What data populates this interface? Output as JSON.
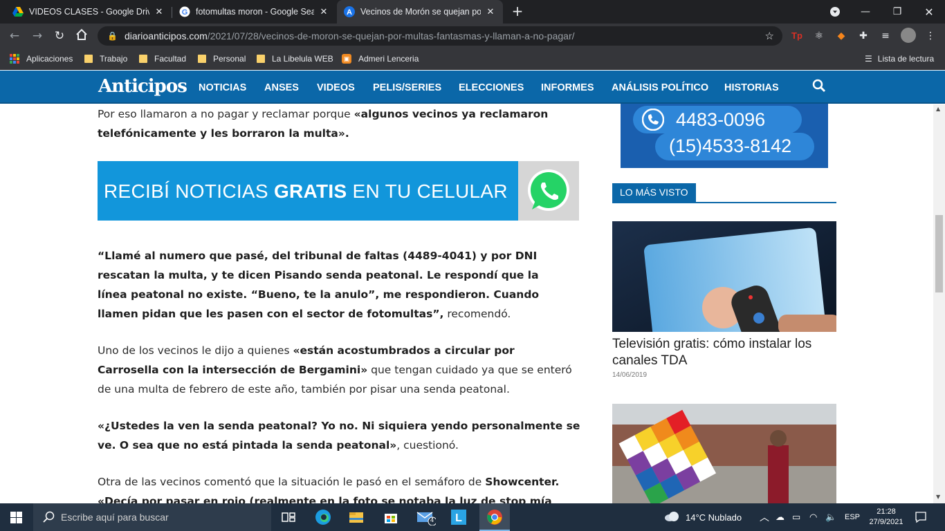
{
  "browser": {
    "tabs": [
      {
        "title": "VIDEOS CLASES - Google Drive",
        "icon": "google-drive-icon"
      },
      {
        "title": "fotomultas moron - Google Search",
        "icon": "google-icon"
      },
      {
        "title": "Vecinos de Morón se quejan por",
        "icon": "site-icon"
      }
    ],
    "url_host": "diarioanticipos.com",
    "url_path": "/2021/07/28/vecinos-de-moron-se-quejan-por-multas-fantasmas-y-llaman-a-no-pagar/",
    "bookmarks": [
      {
        "label": "Aplicaciones",
        "icon": "apps-grid-icon"
      },
      {
        "label": "Trabajo",
        "icon": "folder-icon"
      },
      {
        "label": "Facultad",
        "icon": "folder-icon"
      },
      {
        "label": "Personal",
        "icon": "folder-icon"
      },
      {
        "label": "La Libelula WEB",
        "icon": "folder-icon"
      },
      {
        "label": "Admeri Lenceria",
        "icon": "bookmark-site-icon"
      }
    ],
    "reading_list": "Lista de lectura"
  },
  "site": {
    "logo": "Anticipos",
    "nav": [
      "NOTICIAS",
      "ANSES",
      "VIDEOS",
      "PELIS/SERIES",
      "ELECCIONES",
      "INFORMES",
      "ANÁLISIS POLÍTICO",
      "HISTORIAS"
    ],
    "brand_color": "#0b67a8"
  },
  "article": {
    "p1_normal": "Por eso llamaron a no pagar y reclamar porque ",
    "p1_bold": "«algunos vecinos ya reclamaron telefónicamente y les borraron la multa».",
    "banner_pre": "RECIBÍ NOTICIAS ",
    "banner_bold": "GRATIS",
    "banner_post": " EN TU CELULAR",
    "p2_bold": "“Llamé al numero que pasé, del tribunal de faltas (4489-4041) y por DNI rescatan la multa, y te dicen Pisando senda peatonal. Le respondí que la línea peatonal no existe. “Bueno, te la anulo”, me respondieron. Cuando llamen pidan que les pasen con el sector de fotomultas”,",
    "p2_normal": " recomendó.",
    "p3_normal_a": "Uno de los vecinos le dijo a quienes ",
    "p3_bold": "«están acostumbrados a circular por Carrosella con la intersección de Bergamini»",
    "p3_normal_b": " que tengan cuidado ya que se enteró de una multa de febrero de este año, también por pisar una senda peatonal.",
    "p4_bold": "«¿Ustedes la ven la senda peatonal? Yo no. Ni siquiera yendo personalmente se ve. O sea que no está pintada la senda peatonal»",
    "p4_normal": ", cuestionó.",
    "p5_normal": "Otra de las vecinos comentó que la situación le pasó en el semáforo de ",
    "p5_bold_a": "Showcenter.",
    "p5_bold_b": " «Decía por pasar en rojo (realmente en la foto se notaba la luz de stop mía"
  },
  "sidebar": {
    "phone_1": "4483-0096",
    "phone_2": "(15)4533-8142",
    "widget_title": "LO MÁS VISTO",
    "card1_title": "Televisión gratis: cómo instalar los canales TDA",
    "card1_date": "14/06/2019"
  },
  "taskbar": {
    "search_placeholder": "Escribe aquí para buscar",
    "mail_badge": "4",
    "weather": "14°C  Nublado",
    "lang": "ESP",
    "time": "21:28",
    "date": "27/9/2021"
  }
}
